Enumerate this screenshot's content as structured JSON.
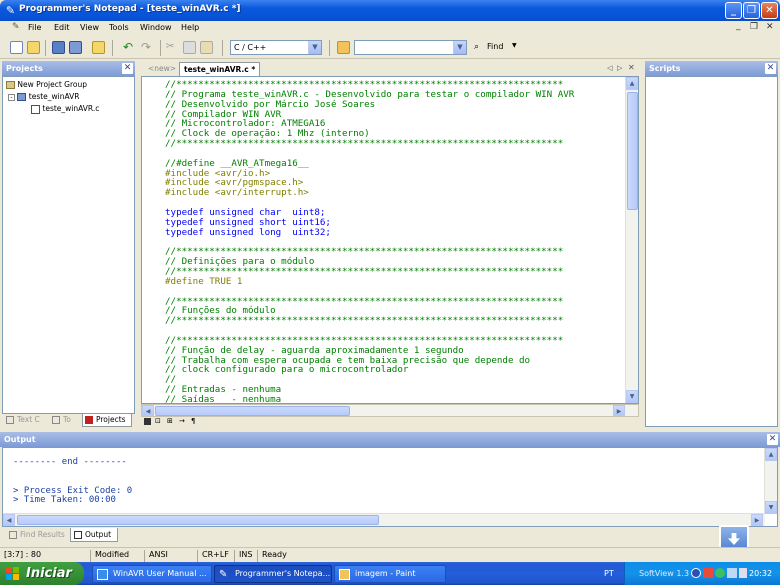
{
  "window": {
    "title": "Programmer's Notepad - [teste_winAVR.c *]"
  },
  "menu": {
    "items": [
      "File",
      "Edit",
      "View",
      "Tools",
      "Window",
      "Help"
    ]
  },
  "toolbar": {
    "scheme": "C / C++",
    "search_value": "",
    "find_label": "Find"
  },
  "projects": {
    "title": "Projects",
    "tree": [
      "New Project Group",
      "teste_winAVR",
      "teste_winAVR.c"
    ],
    "tabs": [
      "Text C",
      "To",
      "Projects"
    ]
  },
  "editor": {
    "tabs": [
      "<new>",
      "teste_winAVR.c *"
    ],
    "lines": [
      {
        "t": "c",
        "s": "//**********************************************************************"
      },
      {
        "t": "c",
        "s": "// Programa teste_winAVR.c - Desenvolvido para testar o compilador WIN AVR"
      },
      {
        "t": "c",
        "s": "// Desenvolvido por Márcio José Soares"
      },
      {
        "t": "c",
        "s": "// Compilador WIN AVR"
      },
      {
        "t": "c",
        "s": "// Microcontrolador: ATMEGA16"
      },
      {
        "t": "c",
        "s": "// Clock de operação: 1 Mhz (interno)"
      },
      {
        "t": "c",
        "s": "//**********************************************************************"
      },
      {
        "t": "n",
        "s": ""
      },
      {
        "t": "c",
        "s": "//#define __AVR_ATmega16__"
      },
      {
        "t": "p",
        "s": "#include <avr/io.h>"
      },
      {
        "t": "p",
        "s": "#include <avr/pgmspace.h>"
      },
      {
        "t": "p",
        "s": "#include <avr/interrupt.h>"
      },
      {
        "t": "n",
        "s": ""
      },
      {
        "t": "k",
        "s": "typedef unsigned char  uint8;"
      },
      {
        "t": "k",
        "s": "typedef unsigned short uint16;"
      },
      {
        "t": "k",
        "s": "typedef unsigned long  uint32;"
      },
      {
        "t": "n",
        "s": ""
      },
      {
        "t": "c",
        "s": "//**********************************************************************"
      },
      {
        "t": "c",
        "s": "// Definições para o módulo"
      },
      {
        "t": "c",
        "s": "//**********************************************************************"
      },
      {
        "t": "p",
        "s": "#define TRUE 1"
      },
      {
        "t": "n",
        "s": ""
      },
      {
        "t": "c",
        "s": "//**********************************************************************"
      },
      {
        "t": "c",
        "s": "// Funções do módulo"
      },
      {
        "t": "c",
        "s": "//**********************************************************************"
      },
      {
        "t": "n",
        "s": ""
      },
      {
        "t": "c",
        "s": "//**********************************************************************"
      },
      {
        "t": "c",
        "s": "// Função de delay - aguarda aproximadamente 1 segundo"
      },
      {
        "t": "c",
        "s": "// Trabalha com espera ocupada e tem baixa precisão que depende do"
      },
      {
        "t": "c",
        "s": "// clock configurado para o microcontrolador"
      },
      {
        "t": "c",
        "s": "//"
      },
      {
        "t": "c",
        "s": "// Entradas - nenhuma"
      },
      {
        "t": "c",
        "s": "// Saídas   - nenhuma"
      }
    ]
  },
  "scripts": {
    "title": "Scripts"
  },
  "output": {
    "title": "Output",
    "lines": [
      "-------- end --------",
      "",
      "",
      "> Process Exit Code: 0",
      "> Time Taken: 00:00"
    ],
    "tabs": [
      "Find Results",
      "Output"
    ]
  },
  "status": {
    "position": "[3:7] : 80",
    "modified": "Modified",
    "encoding": "ANSI",
    "line_end": "CR+LF",
    "ins": "INS",
    "ready": "Ready"
  },
  "taskbar": {
    "start": "Iniciar",
    "tasks": [
      "WinAVR User Manual ...",
      "Programmer's Notepa...",
      "imagem - Paint"
    ],
    "lang": "PT",
    "softview": "SoftView 1.3",
    "clock": "20:32"
  },
  "colors": {
    "comment": "#008000",
    "keyword": "#0000ff",
    "preprocessor": "#808000",
    "output_text": "#1b3fa8"
  }
}
